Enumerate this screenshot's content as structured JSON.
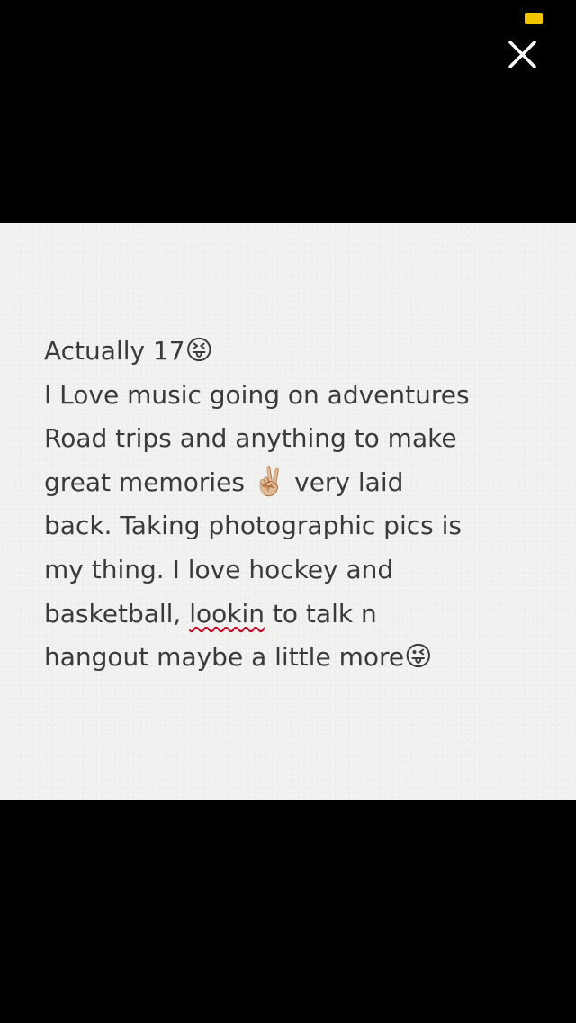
{
  "viewer": {
    "close_icon": "close-icon",
    "status_indicator_color": "#f5c400"
  },
  "note": {
    "line1": {
      "text": "Actually 17",
      "emoji": "😝"
    },
    "line2": "I Love music going on adventures",
    "line3": "Road trips and  anything to make",
    "line4": {
      "before": "great memories ",
      "emoji": "✌🏼",
      "after": " very laid"
    },
    "line5": "back. Taking photographic pics is",
    "line6": "my thing. I love hockey and",
    "line7": {
      "before": "basketball, ",
      "misspelled": "lookin",
      "after": " to talk n"
    },
    "line8": {
      "text": "hangout maybe a little more",
      "emoji": "😜"
    },
    "text_color": "#3a3a3a",
    "spellcheck_color": "#d0021b"
  }
}
